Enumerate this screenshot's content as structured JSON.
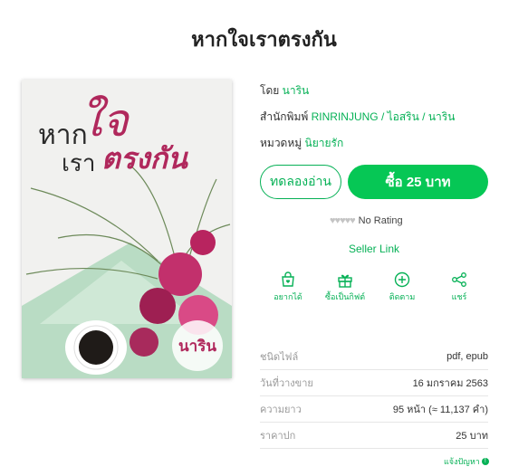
{
  "page": {
    "title": "หากใจเราตรงกัน"
  },
  "cover": {
    "line1": "หาก",
    "line2": "ใจ",
    "line3": "เรา",
    "line4": "ตรงกัน",
    "badge": "นาริน"
  },
  "info": {
    "author_label": "โดย",
    "author": "นาริน",
    "publisher_label": "สำนักพิมพ์",
    "publisher": "RINRINJUNG / ไอสริน / นาริน",
    "category_label": "หมวดหมู่",
    "category": "นิยายรัก"
  },
  "buttons": {
    "try": "ทดลองอ่าน",
    "buy": "ซื้อ 25 บาท"
  },
  "rating": {
    "hearts_icon": "heart-icon",
    "text": "No Rating"
  },
  "seller_link": "Seller Link",
  "actions": [
    {
      "label": "อยากได้",
      "icon": "bag-heart-icon"
    },
    {
      "label": "ซื้อเป็นกิฟต์",
      "icon": "gift-icon"
    },
    {
      "label": "ติดตาม",
      "icon": "plus-circle-icon"
    },
    {
      "label": "แชร์",
      "icon": "share-icon"
    }
  ],
  "details": [
    {
      "key": "ชนิดไฟล์",
      "value": "pdf, epub"
    },
    {
      "key": "วันที่วางขาย",
      "value": "16 มกราคม 2563"
    },
    {
      "key": "ความยาว",
      "value": "95 หน้า (≈ 11,137 คำ)"
    },
    {
      "key": "ราคาปก",
      "value": "25 บาท"
    }
  ],
  "report": "แจ้งปัญหา",
  "colors": {
    "accent": "#06c755",
    "link": "#06b156",
    "cover_title": "#b0285c"
  }
}
